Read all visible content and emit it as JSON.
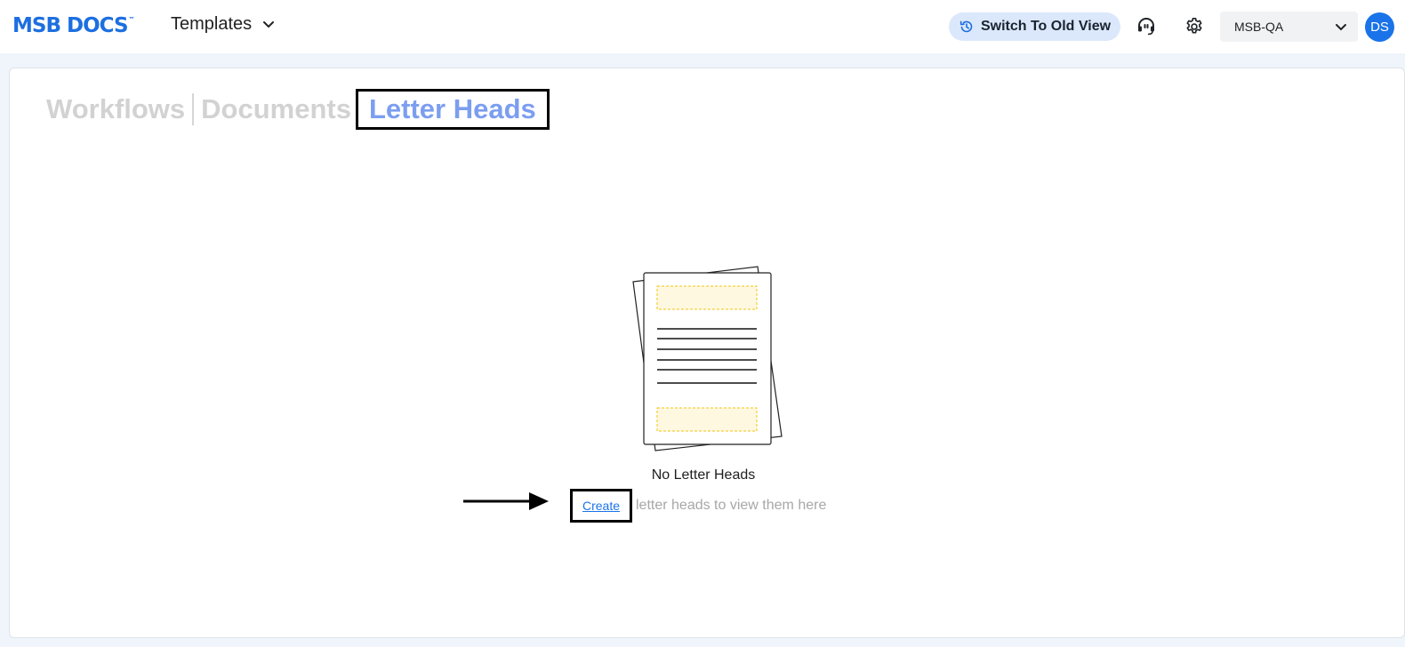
{
  "header": {
    "logo": "MSB DOCS",
    "logo_tm": "™",
    "nav_menu_label": "Templates",
    "switch_view_label": "Switch To Old View",
    "org_selector_value": "MSB-QA",
    "avatar_initials": "DS"
  },
  "tabs": [
    {
      "label": "Workflows",
      "active": false
    },
    {
      "label": "Documents",
      "active": false
    },
    {
      "label": "Letter Heads",
      "active": true
    }
  ],
  "empty_state": {
    "title": "No Letter Heads",
    "create_link": "Create",
    "subtitle_rest": "letter heads to view them here"
  },
  "colors": {
    "brand": "#1d6fe0",
    "active_tab": "#7c9ef0",
    "link": "#1a73e8",
    "switch_btn_bg": "#dbe8fb",
    "avatar_bg": "#1a73e8"
  }
}
